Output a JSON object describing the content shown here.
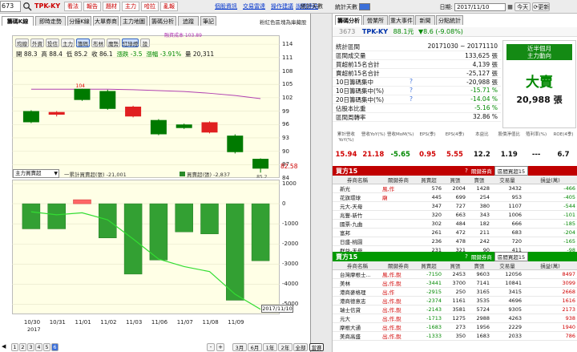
{
  "topbar": {
    "stock_code_value": "673",
    "stock_name": "TPK-KY",
    "buttons": [
      "看法",
      "報告",
      "題材",
      "主力",
      "哈拉",
      "亂報"
    ],
    "links": [
      "個股資訊",
      "交易雷達",
      "操作建議",
      "說明連結"
    ]
  },
  "left": {
    "tabs": [
      "籌碼K線",
      "即時走勢",
      "分鐘K線",
      "大單券商",
      "主力地圖",
      "籌碼分析",
      "追蹤",
      "筆記"
    ],
    "top_right_note": "粉紅色區塊為庫藏股",
    "indicator_buttons": [
      "均線",
      "外資",
      "投信",
      "主力",
      "籌碼",
      "布林",
      "魔勢",
      "紅綠燈",
      "設"
    ],
    "ohlc": {
      "open": "開 88.3",
      "high": "高 88.4",
      "low": "低 85.2",
      "close": "收 86.1",
      "change": "漲跌 -3.5",
      "pct": "漲幅 -3.91%",
      "volume": "量 20,311"
    },
    "cost_label": "融資成本 103.89",
    "top_price_label": "104",
    "low_price_label": "85.2",
    "current_price": "82.58",
    "yticks_top": [
      "114",
      "111",
      "108",
      "105",
      "102",
      "99",
      "96",
      "93",
      "90",
      "87",
      "84"
    ],
    "lower_select": "主力買賣超",
    "legend_line": "一累計買賣超(張) -21,001",
    "legend_bar": "買賣超(張) -2,837",
    "yticks_bottom": [
      "1000",
      "0",
      "-1000",
      "-2000",
      "-3000",
      "-4000",
      "-5000"
    ],
    "xticks": [
      "10/30",
      "10/31",
      "11/01",
      "11/02",
      "11/03",
      "11/06",
      "11/07",
      "11/08",
      "11/09",
      "11/10"
    ],
    "xyear": "2017",
    "date_box": "2017/11/10",
    "pages": [
      "1",
      "2",
      "3",
      "4",
      "5",
      "6"
    ],
    "ranges": [
      "3月",
      "6月",
      "1年",
      "2年",
      "全部",
      "當賽"
    ]
  },
  "right": {
    "tabs": [
      "籌碼分析",
      "營業所",
      "重大事件",
      "新聞",
      "分點統計"
    ],
    "stat_label": "統計天數",
    "date_label": "日期:",
    "date_value": "2017/11/10",
    "today_btn": "今天",
    "refresh_btn": "更新",
    "stock_id": "3673",
    "stock_name": "TPK-KY",
    "price": "88.1元",
    "change": "▼8.6 (-9.08%)",
    "stats": [
      {
        "label": "統計區間",
        "value": "20171030 ~ 20171110",
        "color": "#111"
      },
      {
        "label": "區間成交量",
        "value": "133,625 張",
        "color": "#111"
      },
      {
        "label": "買超前15名合計",
        "value": "4,139 張",
        "color": "#111"
      },
      {
        "label": "賣超前15名合計",
        "value": "-25,127 張",
        "color": "#111"
      },
      {
        "label": "10日籌碼集中",
        "value": "-20,988 張",
        "color": "#111"
      },
      {
        "label": "10日籌碼集中(%)",
        "value": "-15.71 %",
        "color": "#008800"
      },
      {
        "label": "20日籌碼集中(%)",
        "value": "-14.04 %",
        "color": "#008800"
      },
      {
        "label": "佔股本比重",
        "value": "-5.16 %",
        "color": "#008800"
      },
      {
        "label": "區間周轉率",
        "value": "32.86 %",
        "color": "#111"
      }
    ],
    "box_title1": "近半個月",
    "box_title2": "主力動向",
    "box_big": "大賣",
    "box_value": "20,988 張",
    "fin_headers": [
      "累計營收YoY(%)",
      "營收YoY(%)",
      "營收MoM(%)",
      "EPS(季)",
      "EPS(4季)",
      "本益比",
      "股價淨值比",
      "殖利率(%)",
      "ROE(4季)"
    ],
    "fin_values": [
      "15.94",
      "21.18",
      "-5.65",
      "0.95",
      "5.55",
      "12.2",
      "1.19",
      "---",
      "6.7"
    ],
    "fin_colors": [
      "#d00000",
      "#d00000",
      "#008800",
      "#d00000",
      "#d00000",
      "#111",
      "#111",
      "#111",
      "#111"
    ],
    "buy_title": "買方15",
    "sell_title": "賣方15",
    "related_label": "關鍵券商",
    "select_value": "區間買超15",
    "table_headers": [
      "券商名稱",
      "關鍵券商",
      "買賣超",
      "買張",
      "賣張",
      "交易量",
      "損益(萬)"
    ],
    "buy_rows": [
      [
        "新光",
        "風,作",
        "576",
        "2004",
        "1428",
        "3432",
        "-466"
      ],
      [
        "花旗環球",
        "廟",
        "445",
        "699",
        "254",
        "953",
        "-405"
      ],
      [
        "元大-天母",
        "",
        "347",
        "727",
        "380",
        "1107",
        "-544"
      ],
      [
        "兆豐-新竹",
        "",
        "320",
        "663",
        "343",
        "1006",
        "-101"
      ],
      [
        "國票-九曲",
        "",
        "302",
        "484",
        "182",
        "666",
        "-185"
      ],
      [
        "富邦",
        "",
        "261",
        "472",
        "211",
        "683",
        "-204"
      ],
      [
        "日盛-桃園",
        "",
        "236",
        "478",
        "242",
        "720",
        "-165"
      ],
      [
        "群益-天母",
        "",
        "231",
        "321",
        "90",
        "411",
        "-98"
      ],
      [
        "元大-成功",
        "",
        "226",
        "534",
        "308",
        "842",
        "-18"
      ]
    ],
    "sell_rows": [
      [
        "台灣摩根士...",
        "風,作,銳",
        "-7150",
        "2453",
        "9603",
        "12056",
        "8497"
      ],
      [
        "美林",
        "出,作,銳",
        "-3441",
        "3700",
        "7141",
        "10841",
        "3099"
      ],
      [
        "港商麥格理",
        "出,作",
        "-2915",
        "250",
        "3165",
        "3415",
        "2668"
      ],
      [
        "港商德意志",
        "出,作,銳",
        "-2374",
        "1161",
        "3535",
        "4696",
        "1616"
      ],
      [
        "瑞士信貸",
        "出,作,銳",
        "-2143",
        "3581",
        "5724",
        "9305",
        "2173"
      ],
      [
        "元大",
        "出,作,銳",
        "-1713",
        "1275",
        "2988",
        "4263",
        "938"
      ],
      [
        "摩根大通",
        "出,作,銳",
        "-1683",
        "273",
        "1956",
        "2229",
        "1940"
      ],
      [
        "美商高盛",
        "出,作,銳",
        "-1333",
        "350",
        "1683",
        "2033",
        "786"
      ]
    ]
  },
  "chart_data": [
    {
      "type": "candlestick",
      "title": "TPK-KY",
      "x": [
        "10/30",
        "10/31",
        "11/01",
        "11/02",
        "11/03",
        "11/06",
        "11/07",
        "11/08",
        "11/09",
        "11/10"
      ],
      "open": [
        99.0,
        98.2,
        104.0,
        103.5,
        97.8,
        97.0,
        96.0,
        94.2,
        93.5,
        88.3
      ],
      "close": [
        96.5,
        98.8,
        101.5,
        99.5,
        100.0,
        93.8,
        95.2,
        96.5,
        89.8,
        86.1
      ],
      "high": [
        99.2,
        99.0,
        104.0,
        103.8,
        100.2,
        97.2,
        96.2,
        96.7,
        93.8,
        88.4
      ],
      "low": [
        96.3,
        97.8,
        101.3,
        99.3,
        97.6,
        93.6,
        95.0,
        94.0,
        89.5,
        85.2
      ],
      "cost_line": [
        103.9,
        103.9,
        103.9,
        103.9,
        103.8,
        103.6,
        103.4,
        103.0,
        102.5,
        101.8
      ],
      "ylim": [
        84,
        116
      ]
    },
    {
      "type": "bar",
      "series": [
        {
          "name": "買賣超(張)",
          "values": [
            -1250,
            -1250,
            200,
            -1700,
            -3500,
            -2800,
            -1400,
            -1500,
            -4800,
            -2837
          ]
        },
        {
          "name": "累計買賣超(張)",
          "values": [
            -1600,
            -2200,
            -1800,
            -3200,
            -7000,
            -11000,
            -12500,
            -13500,
            -18000,
            -21001
          ]
        }
      ],
      "x": [
        "10/30",
        "10/31",
        "11/01",
        "11/02",
        "11/03",
        "11/06",
        "11/07",
        "11/08",
        "11/09",
        "11/10"
      ],
      "ylim": [
        -5500,
        1200
      ]
    }
  ]
}
